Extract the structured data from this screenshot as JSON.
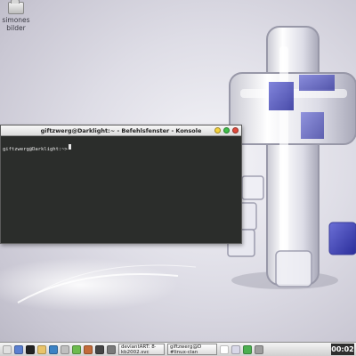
{
  "desktop": {
    "icon_line1": "simones",
    "icon_line2": "bilder"
  },
  "konsole": {
    "title": "giftzwerg@Darklight:~ - Befehlsfenster - Konsole",
    "prompt": "giftzwerg@Darklight:~>"
  },
  "taskbar": {
    "launchers": [
      {
        "icon": "kmenu-icon",
        "color": "#e0e0e0"
      },
      {
        "icon": "desktop-icon",
        "color": "#5a7fd0"
      },
      {
        "icon": "terminal-icon",
        "color": "#222222"
      },
      {
        "icon": "home-folder-icon",
        "color": "#e9c46a"
      },
      {
        "icon": "browser-icon",
        "color": "#3b82c4"
      },
      {
        "icon": "mail-icon",
        "color": "#bfbfbf"
      },
      {
        "icon": "kopete-icon",
        "color": "#6dbb4e"
      },
      {
        "icon": "cd-burner-icon",
        "color": "#c26b3a"
      },
      {
        "icon": "media-player-icon",
        "color": "#444444"
      },
      {
        "icon": "settings-icon",
        "color": "#7a7a7a"
      }
    ],
    "tasks": [
      {
        "line1": "deviantART: 8·",
        "line2": "kb2002.svc"
      },
      {
        "line1": "giftzwerg@D",
        "line2": "#linux-clan"
      }
    ],
    "clock": "00:02"
  }
}
